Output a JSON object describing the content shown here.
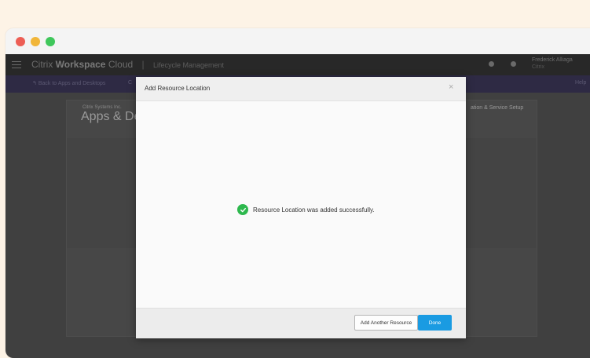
{
  "app": {
    "brand_prefix": "Citrix ",
    "brand_bold": "Workspace",
    "brand_suffix": " Cloud",
    "separator": "|",
    "section": "Lifecycle Management",
    "user_name": "Frederick Alliaga",
    "user_org": "Citrix"
  },
  "subnav": {
    "back_label": "Back to Apps and Desktops",
    "crumb": "C",
    "help": "Help"
  },
  "page": {
    "company": "Citrix Systems Inc.",
    "title": "Apps & Des",
    "right_link": "ation & Service Setup"
  },
  "modal": {
    "title": "Add Resource Location",
    "close_glyph": "×",
    "success_message": "Resource Location was added successfully.",
    "add_another_label": "Add Another Resource",
    "done_label": "Done"
  },
  "colors": {
    "primary": "#1a9be2",
    "success": "#2db84d"
  }
}
